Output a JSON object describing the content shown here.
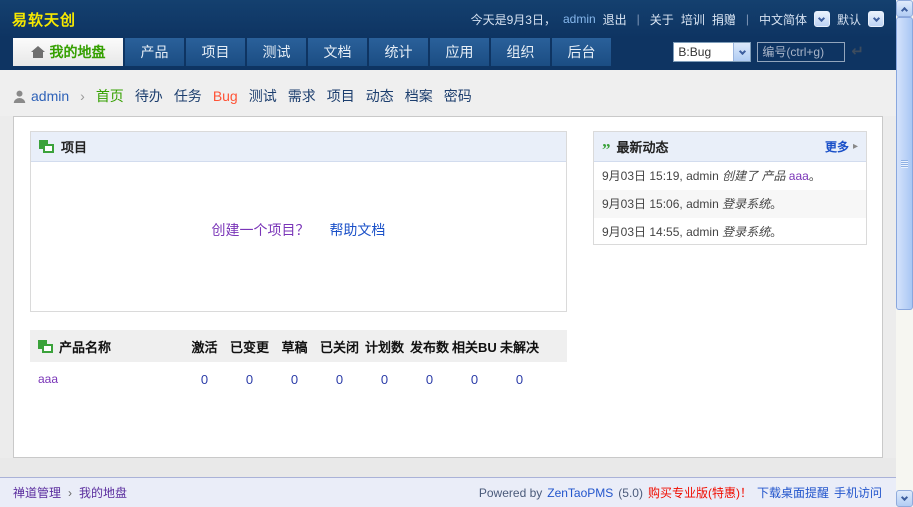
{
  "topbar": {
    "logo": "易软天创",
    "today": "今天是9月3日，",
    "user": "admin",
    "logout": "退出",
    "link_about": "关于",
    "link_training": "培训",
    "link_donate": "捐赠",
    "language": "中文简体",
    "theme": "默认"
  },
  "tabs": [
    {
      "label": "我的地盘"
    },
    {
      "label": "产品"
    },
    {
      "label": "项目"
    },
    {
      "label": "测试"
    },
    {
      "label": "文档"
    },
    {
      "label": "统计"
    },
    {
      "label": "应用"
    },
    {
      "label": "组织"
    },
    {
      "label": "后台"
    }
  ],
  "search": {
    "module": "B:Bug",
    "placeholder": "编号(ctrl+g)"
  },
  "breadcrumb": {
    "user": "admin",
    "items": [
      "首页",
      "待办",
      "任务",
      "Bug",
      "测试",
      "需求",
      "项目",
      "动态",
      "档案",
      "密码"
    ]
  },
  "project_panel": {
    "title": "项目",
    "create_question": "创建一个项目？",
    "help_doc": "帮助文档"
  },
  "activity": {
    "title": "最新动态",
    "more": "更多",
    "items": [
      {
        "time": "9月03日 15:19,",
        "actor": "admin",
        "action": "创建了 产品",
        "object": "aaa",
        "suffix": "。"
      },
      {
        "time": "9月03日 15:06,",
        "actor": "admin",
        "action": "登录系统",
        "object": "",
        "suffix": "。"
      },
      {
        "time": "9月03日 14:55,",
        "actor": "admin",
        "action": "登录系统",
        "object": "",
        "suffix": "。"
      }
    ]
  },
  "product_table": {
    "name_header": "产品名称",
    "columns": [
      "激活",
      "已变更",
      "草稿",
      "已关闭",
      "计划数",
      "发布数",
      "相关BUG",
      "未解决"
    ],
    "rows": [
      {
        "name": "aaa",
        "values": [
          "0",
          "0",
          "0",
          "0",
          "0",
          "0",
          "0",
          "0"
        ]
      }
    ]
  },
  "footer": {
    "crumb1": "禅道管理",
    "crumb2": "我的地盘",
    "powered": "Powered by",
    "product": "ZenTaoPMS",
    "version": "(5.0)",
    "promo": "购买专业版(特惠)！",
    "link_desktop": "下载桌面提醒",
    "link_mobile": "手机访问"
  },
  "colors": {
    "header_navy": "#0e3462",
    "tab_blue": "#1b4d83",
    "active_green": "#35a000",
    "logo_yellow": "#f7e800",
    "link_blue": "#1a50c8",
    "visited_purple": "#7a35b8",
    "bug_red": "#ff5336",
    "footer_bg": "#eaedf8",
    "panel_header_bg": "#e9eff9"
  }
}
